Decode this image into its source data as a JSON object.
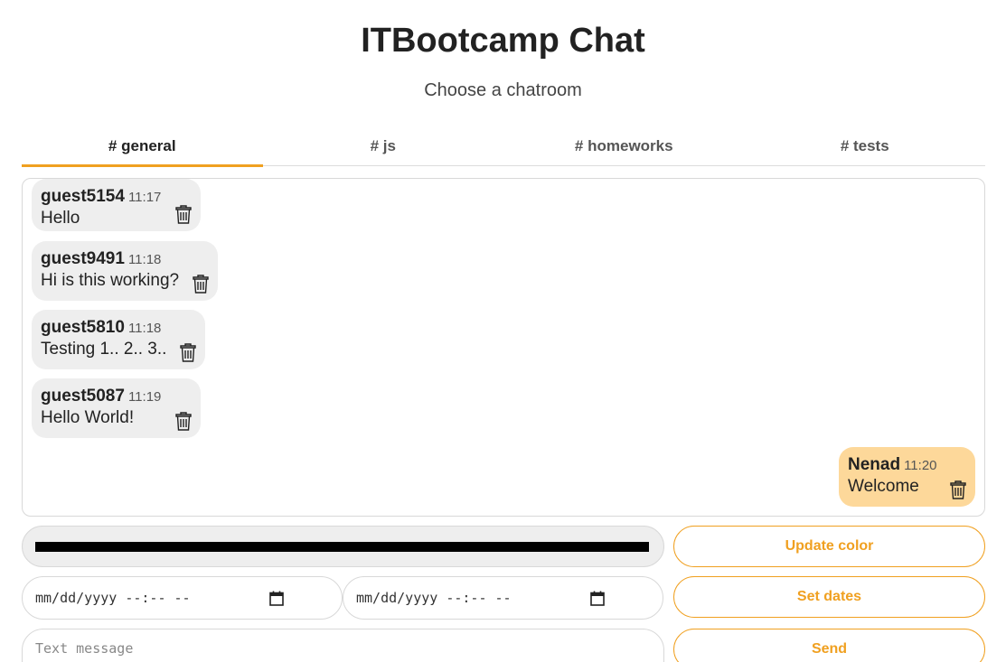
{
  "header": {
    "title": "ITBootcamp Chat",
    "subtitle": "Choose a chatroom"
  },
  "tabs": [
    {
      "label": "# general",
      "active": true
    },
    {
      "label": "# js",
      "active": false
    },
    {
      "label": "# homeworks",
      "active": false
    },
    {
      "label": "# tests",
      "active": false
    }
  ],
  "messages": [
    {
      "user": "guest5154",
      "time": "11:17",
      "text": "Hello",
      "mine": false
    },
    {
      "user": "guest9491",
      "time": "11:18",
      "text": "Hi is this working?",
      "mine": false
    },
    {
      "user": "guest5810",
      "time": "11:18",
      "text": "Testing 1.. 2.. 3..",
      "mine": false
    },
    {
      "user": "guest5087",
      "time": "11:19",
      "text": "Hello World!",
      "mine": false
    },
    {
      "user": "Nenad",
      "time": "11:20",
      "text": "Welcome",
      "mine": true
    }
  ],
  "controls": {
    "color_value": "#000000",
    "update_color_label": "Update color",
    "date_placeholder_1": "mm/dd/yyyy --:-- --",
    "date_placeholder_2": "mm/dd/yyyy --:-- --",
    "set_dates_label": "Set dates",
    "message_placeholder": "Text message",
    "send_label": "Send"
  },
  "colors": {
    "accent": "#f0a020",
    "bubble_other": "#eeeeee",
    "bubble_mine": "#fdd89a"
  }
}
